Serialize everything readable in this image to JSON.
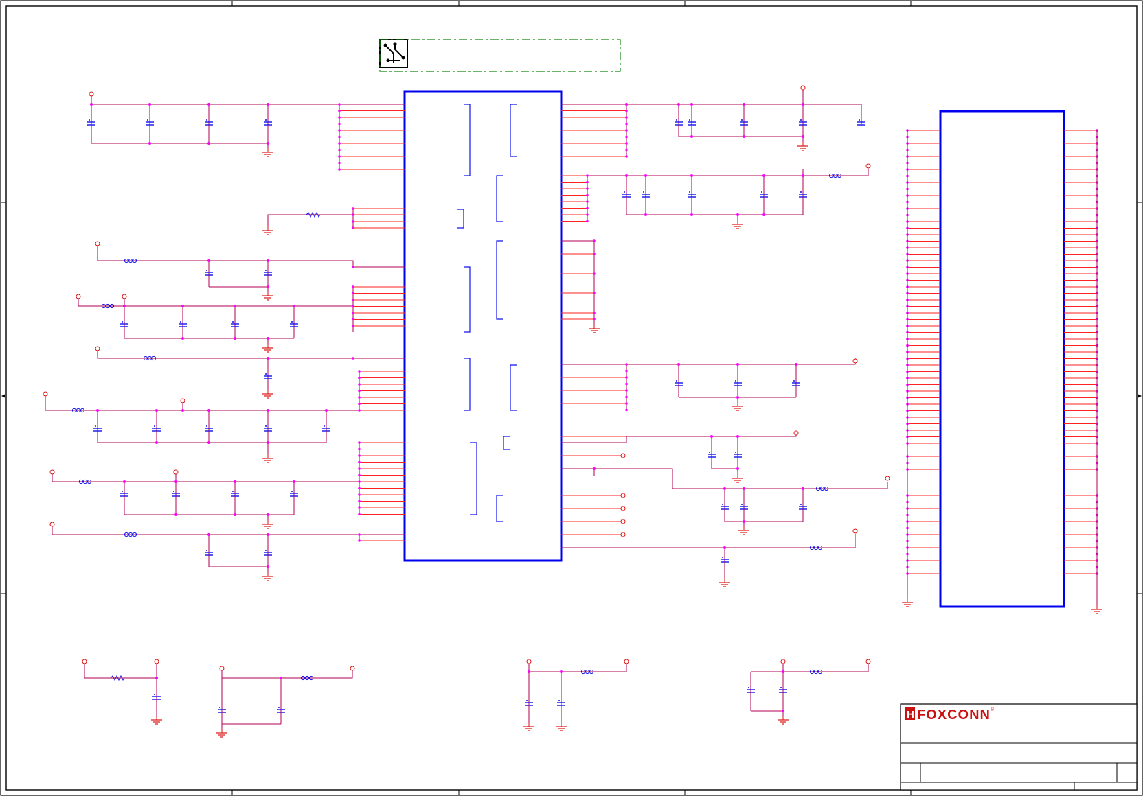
{
  "sheet": {
    "logo_text": "FOXCONN",
    "logo_mark": "H",
    "registered_mark": "®"
  },
  "colors": {
    "wire": "#b00055",
    "pin": "#ff2222",
    "junction": "#ff00ff",
    "component": "#1111ee",
    "ground": "#dd1111",
    "border": "#000000",
    "chip_border": "#0000ee",
    "dashed_box": "#118811",
    "logo": "#cc1111"
  },
  "icons": {
    "pcb_marker": "pcb-circuit-icon",
    "logo": "foxconn-logo-icon",
    "capacitor": "capacitor-icon",
    "inductor": "inductor-icon",
    "resistor": "resistor-icon",
    "ground": "ground-symbol-icon",
    "power": "power-port-icon"
  }
}
